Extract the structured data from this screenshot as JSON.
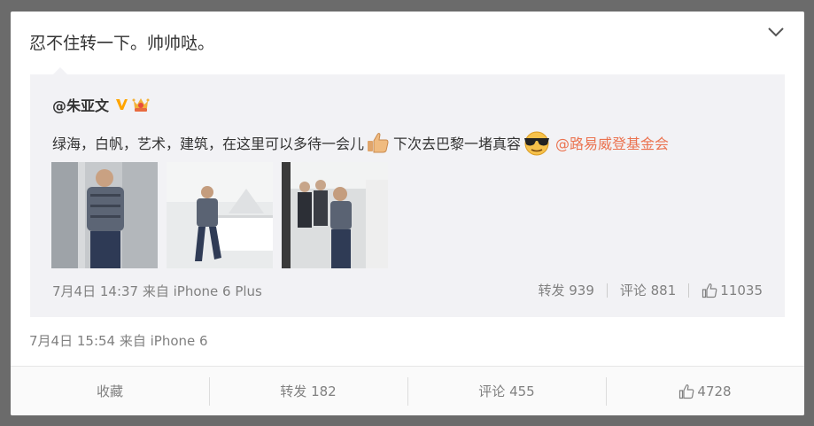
{
  "post": {
    "text": "忍不住转一下。帅帅哒。",
    "meta": "7月4日 15:54 来自 iPhone 6"
  },
  "repost": {
    "author": "@朱亚文",
    "text_part1": "绿海，白帆，艺术，建筑，在这里可以多待一会儿",
    "text_part2": "下次去巴黎一堵真容",
    "mention": "@路易威登基金会",
    "meta": "7月4日 14:37 来自 iPhone 6 Plus",
    "repost_label": "转发 939",
    "comment_label": "评论 881",
    "like_count": "11035"
  },
  "actions": {
    "favorite": "收藏",
    "repost": "转发 182",
    "comment": "评论 455",
    "like": "4728"
  },
  "icons": {
    "collapse": "chevron-down-icon",
    "verified": "verified-v-icon",
    "crown": "member-crown-icon",
    "thumbs_up_emoji": "thumbs-up-emoji",
    "cool_emoji": "sunglasses-emoji",
    "like": "thumbs-up-icon"
  },
  "colors": {
    "mention": "#eb7350",
    "verified": "#ffa500",
    "meta": "#808080"
  }
}
